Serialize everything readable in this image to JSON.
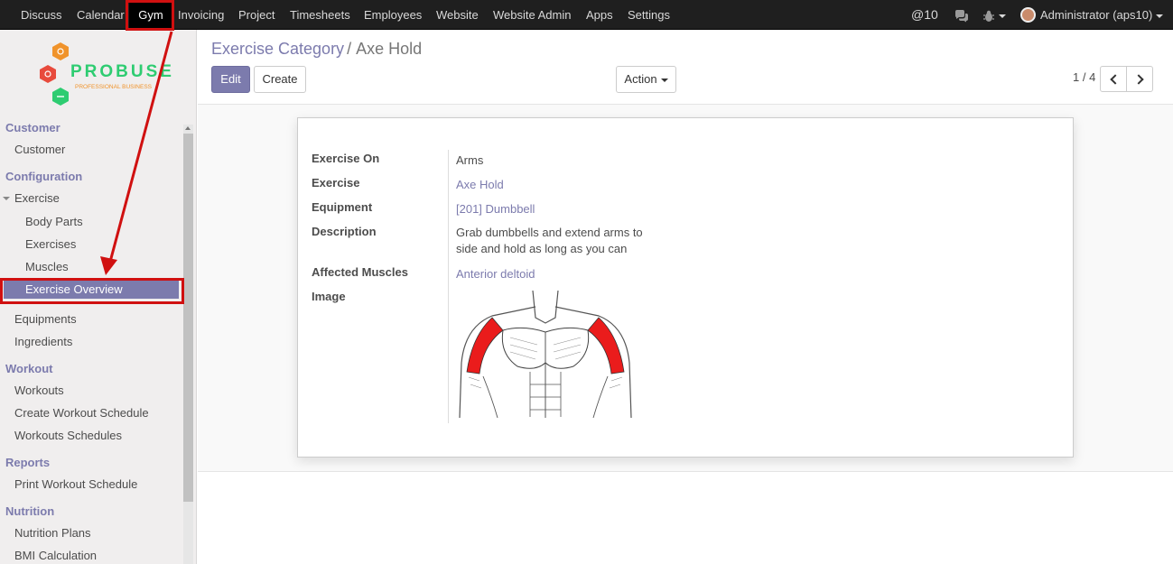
{
  "topbar": {
    "menu": [
      "Discuss",
      "Calendar",
      "Gym",
      "Invoicing",
      "Project",
      "Timesheets",
      "Employees",
      "Website",
      "Website Admin",
      "Apps",
      "Settings"
    ],
    "active_menu": "Gym",
    "mentions": "@10",
    "user": "Administrator (aps10)"
  },
  "logo": {
    "name": "PROBUSE",
    "tagline": "PROFESSIONAL BUSINESS"
  },
  "sidebar": {
    "customer_title": "Customer",
    "customer_item": "Customer",
    "configuration_title": "Configuration",
    "exercise_group": "Exercise",
    "body_parts": "Body Parts",
    "exercises": "Exercises",
    "muscles": "Muscles",
    "exercise_overview": "Exercise Overview",
    "equipments": "Equipments",
    "ingredients": "Ingredients",
    "workout_title": "Workout",
    "workouts": "Workouts",
    "create_workout_schedule": "Create Workout Schedule",
    "workouts_schedules": "Workouts Schedules",
    "reports_title": "Reports",
    "print_workout_schedule": "Print Workout Schedule",
    "nutrition_title": "Nutrition",
    "nutrition_plans": "Nutrition Plans",
    "bmi_calculation": "BMI Calculation"
  },
  "breadcrumb": {
    "parent": "Exercise Category",
    "separator": "/",
    "current": "Axe Hold"
  },
  "toolbar": {
    "edit_label": "Edit",
    "create_label": "Create",
    "action_label": "Action"
  },
  "pager": {
    "value": "1 / 4"
  },
  "form": {
    "exercise_on_label": "Exercise On",
    "exercise_on_value": "Arms",
    "exercise_label": "Exercise",
    "exercise_value": "Axe Hold",
    "equipment_label": "Equipment",
    "equipment_value": "[201] Dumbbell",
    "description_label": "Description",
    "description_value": "Grab dumbbells and extend arms to side and hold as long as you can",
    "affected_muscles_label": "Affected Muscles",
    "affected_muscles_value": "Anterior deltoid",
    "image_label": "Image"
  },
  "colors": {
    "topbar_bg": "#1f1f1f",
    "accent": "#7c7bad",
    "sidebar_bg": "#f0eeee",
    "annotation_red": "#d01010"
  }
}
